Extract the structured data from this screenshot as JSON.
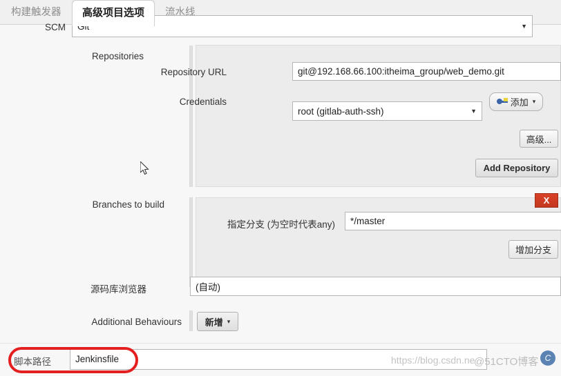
{
  "tabs": [
    {
      "label": "构建触发器",
      "active": false
    },
    {
      "label": "高级项目选项",
      "active": true
    },
    {
      "label": "流水线",
      "active": false
    }
  ],
  "scm_row": {
    "label": "SCM",
    "value": "Git"
  },
  "repositories": {
    "label": "Repositories",
    "repository_url_label": "Repository URL",
    "repository_url_value": "git@192.168.66.100:itheima_group/web_demo.git",
    "credentials_label": "Credentials",
    "credentials_value": "root (gitlab-auth-ssh)",
    "add_credentials_button": "添加",
    "advanced_button": "高级...",
    "add_repository_button": "Add Repository"
  },
  "branches": {
    "label": "Branches to build",
    "branch_specifier_label": "指定分支 (为空时代表any)",
    "branch_specifier_value": "*/master",
    "add_branch_button": "增加分支",
    "delete_button": "X"
  },
  "repository_browser": {
    "label": "源码库浏览器",
    "value": "(自动)"
  },
  "additional_behaviours": {
    "label": "Additional Behaviours",
    "add_button": "新增"
  },
  "script_path": {
    "label": "脚本路径",
    "value": "Jenkinsfile"
  },
  "watermark": {
    "url_text": "https://blog.csdn.ne",
    "site_text": "@51CTO博客",
    "logo_glyph": "C"
  },
  "icons": {
    "caret_down": "▼",
    "caret_small": "▾"
  },
  "colors": {
    "accent_red": "#e41f1f",
    "delete_red": "#d94127",
    "panel_bg": "#ececec",
    "page_bg": "#f7f7f7"
  }
}
